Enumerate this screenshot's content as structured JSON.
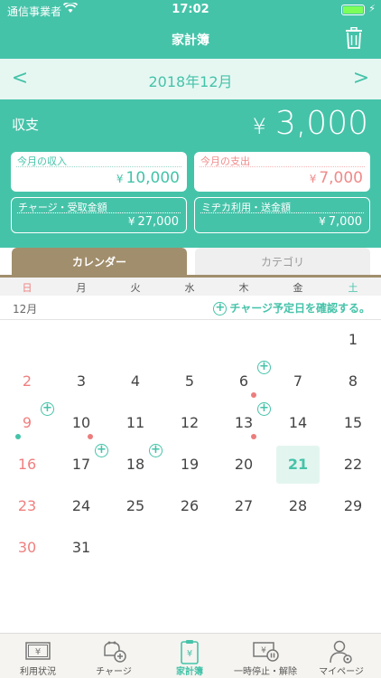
{
  "status": {
    "carrier": "通信事業者",
    "time": "17:02",
    "battery_level": 1.0
  },
  "header": {
    "title": "家計簿",
    "trash_icon": "trash-icon"
  },
  "month_nav": {
    "prev": "<",
    "next": ">",
    "month": "2018年12月"
  },
  "summary": {
    "label": "収支",
    "yen": "¥",
    "total": "3,000",
    "income": {
      "label": "今月の収入",
      "yen": "¥",
      "value": "10,000"
    },
    "expense": {
      "label": "今月の支出",
      "yen": "¥",
      "value": "7,000"
    },
    "charge": {
      "label": "チャージ・受取金額",
      "yen": "¥",
      "value": "27,000"
    },
    "usage": {
      "label": "ミヂカ利用・送金額",
      "yen": "¥",
      "value": "7,000"
    }
  },
  "tabs": {
    "calendar": "カレンダー",
    "category": "カテゴリ"
  },
  "weekdays": [
    "日",
    "月",
    "火",
    "水",
    "木",
    "金",
    "土"
  ],
  "calendar": {
    "month_label": "12月",
    "confirm_label": "チャージ予定日を確認する。",
    "days": [
      "1",
      "2",
      "3",
      "4",
      "5",
      "6",
      "7",
      "8",
      "9",
      "10",
      "11",
      "12",
      "13",
      "14",
      "15",
      "16",
      "17",
      "18",
      "19",
      "20",
      "21",
      "22",
      "23",
      "24",
      "25",
      "26",
      "27",
      "28",
      "29",
      "30",
      "31"
    ],
    "today": "21"
  },
  "tabbar": {
    "items": [
      {
        "label": "利用状況",
        "icon": "usage-icon"
      },
      {
        "label": "チャージ",
        "icon": "charge-icon"
      },
      {
        "label": "家計簿",
        "icon": "budget-book-icon"
      },
      {
        "label": "一時停止・解除",
        "icon": "pause-icon"
      },
      {
        "label": "マイページ",
        "icon": "mypage-icon"
      }
    ],
    "active": 2
  },
  "colors": {
    "primary": "#45c3a9",
    "expense": "#f08a8a",
    "tab_active": "#a18e6c"
  }
}
